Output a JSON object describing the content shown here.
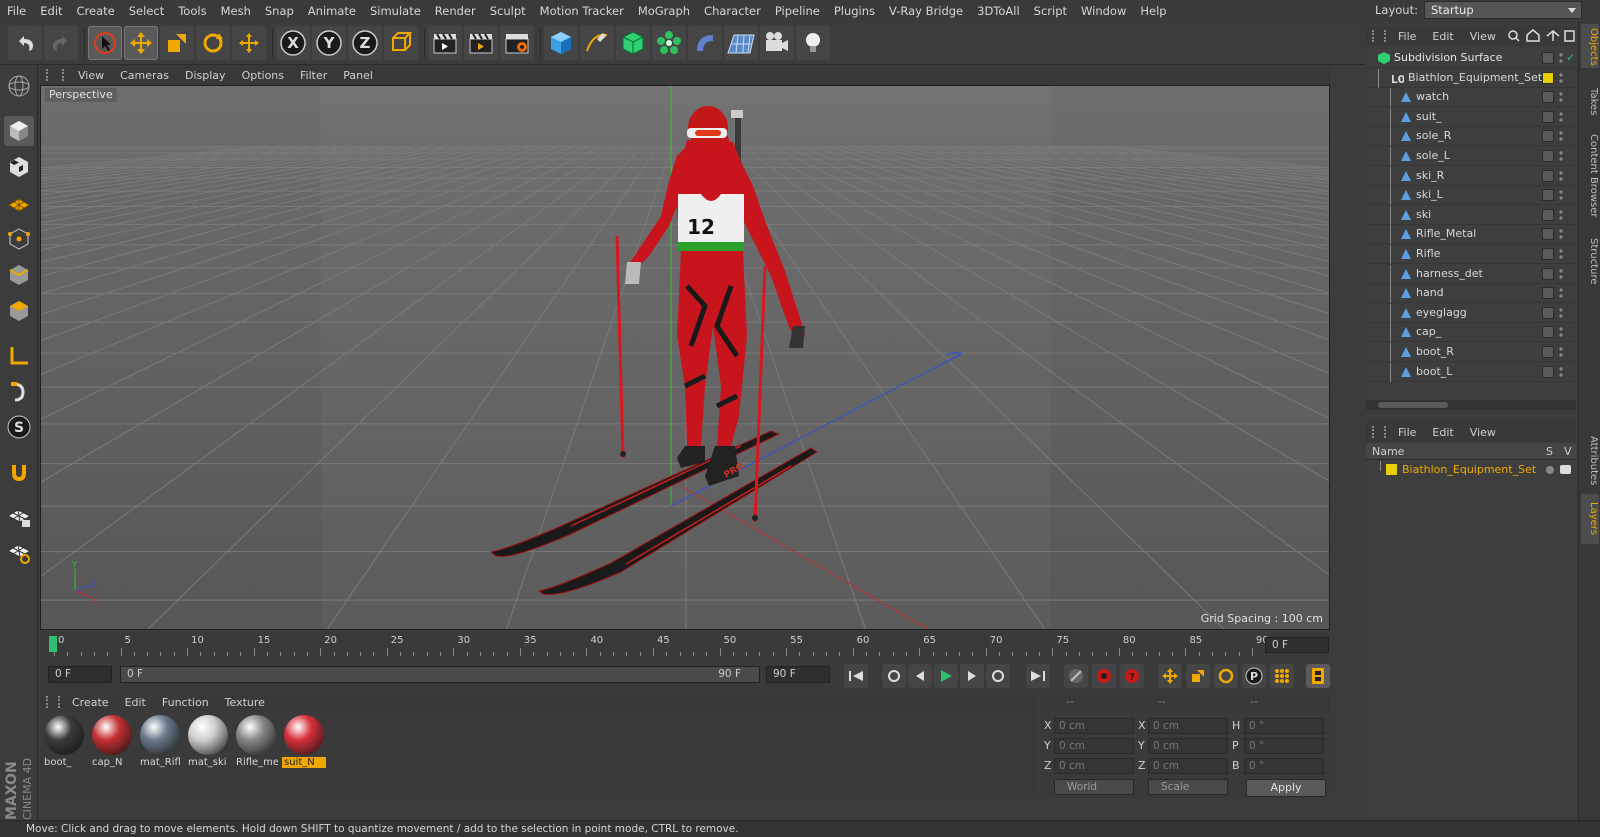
{
  "menu": [
    "File",
    "Edit",
    "Create",
    "Select",
    "Tools",
    "Mesh",
    "Snap",
    "Animate",
    "Simulate",
    "Render",
    "Sculpt",
    "Motion Tracker",
    "MoGraph",
    "Character",
    "Pipeline",
    "Plugins",
    "V-Ray Bridge",
    "3DToAll",
    "Script",
    "Window",
    "Help"
  ],
  "layout": {
    "label": "Layout:",
    "value": "Startup"
  },
  "viewport": {
    "menu": [
      "View",
      "Cameras",
      "Display",
      "Options",
      "Filter",
      "Panel"
    ],
    "label": "Perspective",
    "grid_spacing": "Grid Spacing : 100 cm",
    "bib_number": "12",
    "ski_text": "PRO",
    "axis": {
      "y": "Y",
      "z": "Z",
      "x": "X"
    }
  },
  "timeline": {
    "ticks": [
      "0",
      "5",
      "10",
      "15",
      "20",
      "25",
      "30",
      "35",
      "40",
      "45",
      "50",
      "55",
      "60",
      "65",
      "70",
      "75",
      "80",
      "85",
      "90"
    ],
    "current": "0 F",
    "start": "0 F",
    "range_start": "0 F",
    "range_end": "90 F",
    "end": "90 F"
  },
  "materials": {
    "menu": [
      "Create",
      "Edit",
      "Function",
      "Texture"
    ],
    "items": [
      {
        "label": "boot_",
        "color": "#3a3a3a"
      },
      {
        "label": "cap_N",
        "color": "#c43030"
      },
      {
        "label": "mat_Rifl",
        "color": "#6a7a8a"
      },
      {
        "label": "mat_ski",
        "color": "#cfcfcf"
      },
      {
        "label": "Rifle_me",
        "color": "#888888"
      },
      {
        "label": "suit_N",
        "color": "#d8303a",
        "selected": true
      }
    ]
  },
  "coords": {
    "header": [
      "--",
      "--",
      "--"
    ],
    "rows": [
      {
        "a": "X",
        "av": "0 cm",
        "b": "X",
        "bv": "0 cm",
        "c": "H",
        "cv": "0 °"
      },
      {
        "a": "Y",
        "av": "0 cm",
        "b": "Y",
        "bv": "0 cm",
        "c": "P",
        "cv": "0 °"
      },
      {
        "a": "Z",
        "av": "0 cm",
        "b": "Z",
        "bv": "0 cm",
        "c": "B",
        "cv": "0 °"
      }
    ],
    "world": "World",
    "scale": "Scale",
    "apply": "Apply"
  },
  "status": "Move: Click and drag to move elements. Hold down SHIFT to quantize movement / add to the selection in point mode, CTRL to remove.",
  "objects": {
    "menu": [
      "File",
      "Edit",
      "View"
    ],
    "items": [
      {
        "name": "Subdivision Surface",
        "level": 0,
        "type": "subdiv"
      },
      {
        "name": "Biathlon_Equipment_Set",
        "level": 1,
        "type": "null"
      },
      {
        "name": "watch",
        "level": 2,
        "type": "poly"
      },
      {
        "name": "suit_",
        "level": 2,
        "type": "poly"
      },
      {
        "name": "sole_R",
        "level": 2,
        "type": "poly"
      },
      {
        "name": "sole_L",
        "level": 2,
        "type": "poly"
      },
      {
        "name": "ski_R",
        "level": 2,
        "type": "poly"
      },
      {
        "name": "ski_L",
        "level": 2,
        "type": "poly"
      },
      {
        "name": "ski",
        "level": 2,
        "type": "poly"
      },
      {
        "name": "Rifle_Metal",
        "level": 2,
        "type": "poly"
      },
      {
        "name": "Rifle",
        "level": 2,
        "type": "poly"
      },
      {
        "name": "harness_det",
        "level": 2,
        "type": "poly"
      },
      {
        "name": "hand",
        "level": 2,
        "type": "poly"
      },
      {
        "name": "eyeglagg",
        "level": 2,
        "type": "poly"
      },
      {
        "name": "cap_",
        "level": 2,
        "type": "poly"
      },
      {
        "name": "boot_R",
        "level": 2,
        "type": "poly"
      },
      {
        "name": "boot_L",
        "level": 2,
        "type": "poly"
      }
    ]
  },
  "layers": {
    "menu": [
      "File",
      "Edit",
      "View"
    ],
    "cols": {
      "name": "Name",
      "s": "S",
      "v": "V"
    },
    "items": [
      {
        "name": "Biathlon_Equipment_Set",
        "color": "#e8d000"
      }
    ]
  },
  "sidetabs": [
    "Objects",
    "Takes",
    "Content Browser",
    "Structure",
    "Attributes",
    "Layers"
  ],
  "colors": {
    "accent": "#f0a800",
    "suit": "#c8141c",
    "bg": "#3c3c3c"
  }
}
